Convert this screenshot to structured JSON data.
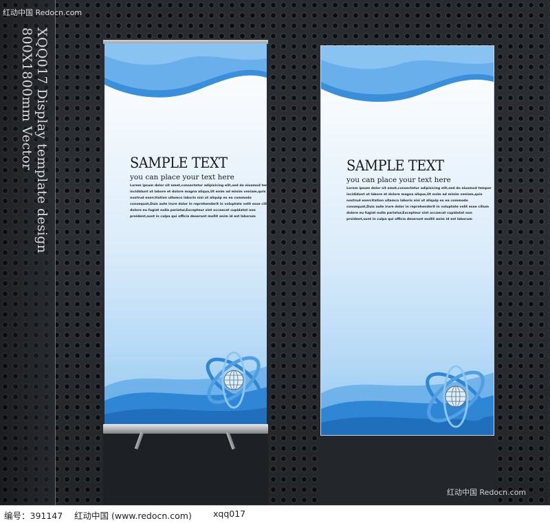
{
  "watermark": {
    "top_left": "红动中国 Redocn.com",
    "bottom_right": "红动中国 Redocn.com"
  },
  "side_caption": {
    "line1": "XQQ017 Display template design",
    "line2": "800X1800mm Vector"
  },
  "banners": [
    {
      "title": "SAMPLE TEXT",
      "subtitle": "you can place your text here",
      "body": [
        "Lorem ipsum dolor sit amet,consectetur adipisicing elit,sed do eiusmod tempor",
        "incididunt ut labore et dolore magna aliqua,Ut enim ad minim veniam,quis",
        "nostrud exercitation ullamco laboris nisi ut aliquip ex ea commodo",
        "consequat,Duis aute irure dolor in reprehenderit in voluptate velit esse cillum",
        "dolore eu fugiat nulla pariatur,Excepteur sint occaecat cupidatat non",
        "proident,sunt in culpa qui officia deserunt mollit anim id est laborum"
      ]
    },
    {
      "title": "SAMPLE TEXT",
      "subtitle": "you can place your text here",
      "body": [
        "Lorem ipsum dolor sit amet,consectetur adipisicing elit,sed do eiusmod tempor",
        "incididunt ut labore et dolore magna aliqua,Ut enim ad minim veniam,quis",
        "nostrud exercitation ullamco laboris nisi ut aliquip ex ea commodo",
        "consequat,Duis aute irure dolor in reprehenderit in voluptate velit esse cillum",
        "dolore eu fugiat nulla pariatur,Excepteur sint occaecat cupidatat non",
        "proident,sunt in culpa qui officia deserunt mollit anim id est laborum"
      ]
    }
  ],
  "footer": {
    "id_label": "编号：391147",
    "site": "红动中国 (www.redocn.com)",
    "code": "xqq017"
  },
  "colors": {
    "wave_dark": "#2f86d4",
    "wave_light": "#7fbdf0",
    "background": "#2e3136"
  }
}
